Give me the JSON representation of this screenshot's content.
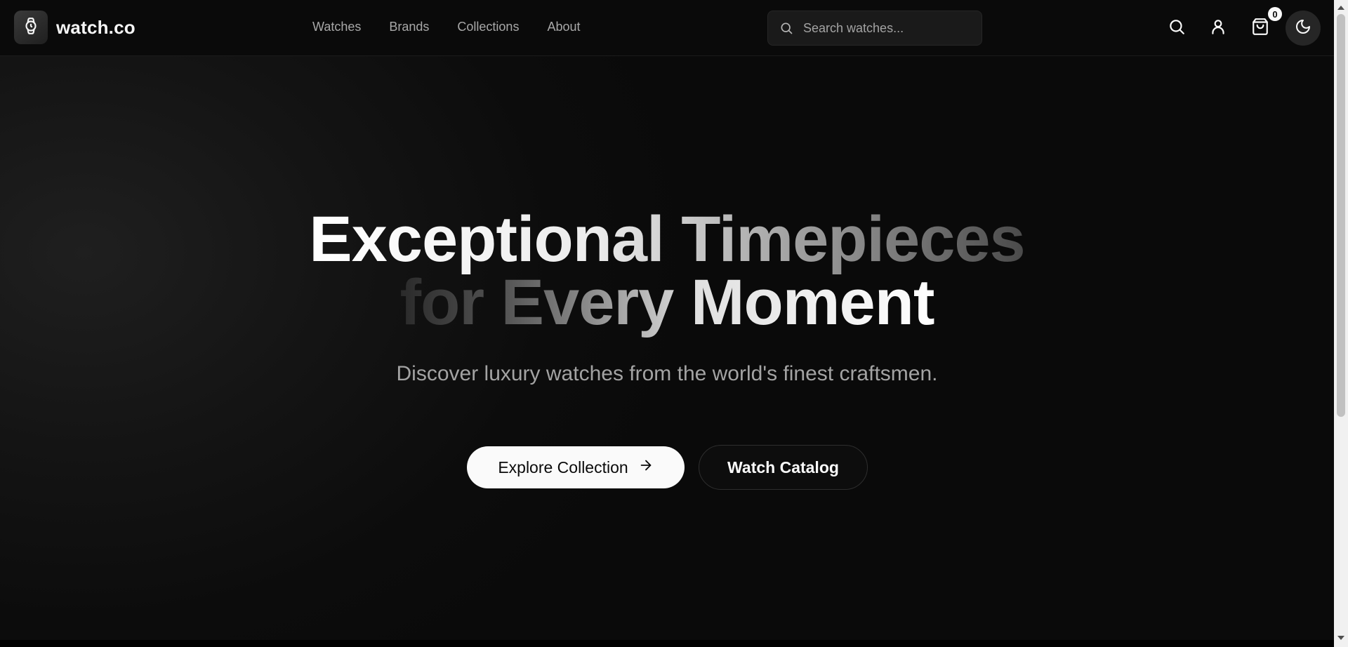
{
  "brand": {
    "name": "watch.co",
    "logo_icon": "watch-icon"
  },
  "nav": {
    "items": [
      {
        "label": "Watches"
      },
      {
        "label": "Brands"
      },
      {
        "label": "Collections"
      },
      {
        "label": "About"
      }
    ]
  },
  "search": {
    "placeholder": "Search watches...",
    "value": "",
    "icon": "search-icon"
  },
  "header_actions": {
    "search_icon": "search-icon",
    "account_icon": "user-icon",
    "cart_icon": "shopping-bag-icon",
    "cart_count": "0",
    "theme_icon": "moon-icon"
  },
  "hero": {
    "title_line1": "Exceptional Timepieces",
    "title_line2": "for Every Moment",
    "subtitle": "Discover luxury watches from the world's finest craftsmen.",
    "primary_cta": "Explore Collection",
    "primary_cta_icon": "arrow-right-icon",
    "secondary_cta": "Watch Catalog"
  },
  "colors": {
    "background": "#0a0a0a",
    "text": "#fafafa",
    "muted": "#a3a3a3",
    "primary_button": "#fafafa"
  }
}
